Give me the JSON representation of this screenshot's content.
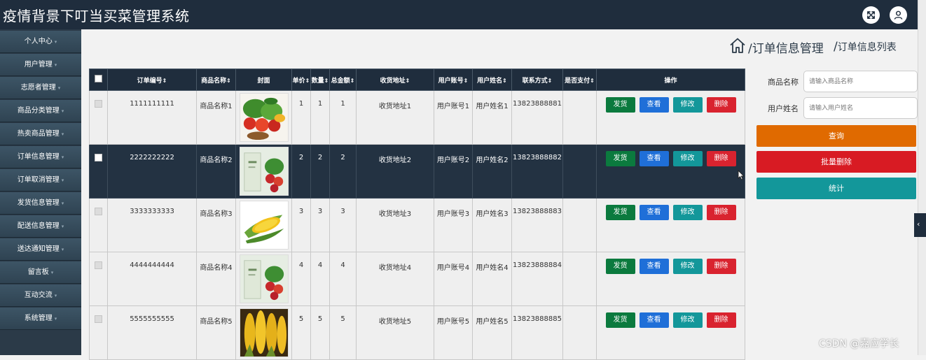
{
  "app": {
    "title": "疫情背景下叮当买菜管理系统"
  },
  "topbar": {
    "icons": [
      "fullscreen-icon",
      "user-icon"
    ]
  },
  "sidebar": {
    "items": [
      {
        "label": "个人中心"
      },
      {
        "label": "用户管理"
      },
      {
        "label": "志愿者管理"
      },
      {
        "label": "商品分类管理"
      },
      {
        "label": "热卖商品管理"
      },
      {
        "label": "订单信息管理"
      },
      {
        "label": "订单取消管理"
      },
      {
        "label": "发货信息管理"
      },
      {
        "label": "配送信息管理"
      },
      {
        "label": "送达通知管理"
      },
      {
        "label": "留言板"
      },
      {
        "label": "互动交流"
      },
      {
        "label": "系统管理"
      }
    ]
  },
  "breadcrumb": {
    "section": "订单信息管理",
    "page": "订单信息列表",
    "separator": "/"
  },
  "table": {
    "headers": {
      "order_no": "订单编号",
      "product_name": "商品名称",
      "cover": "封面",
      "unit_price": "单价",
      "quantity": "数量",
      "total": "总金额",
      "address": "收货地址",
      "account": "用户账号",
      "user_name": "用户姓名",
      "phone": "联系方式",
      "paid": "是否支付",
      "actions": "操作"
    },
    "sort_glyph": "⇕",
    "rows": [
      {
        "order_no": "1111111111",
        "product_name": "商品名称1",
        "cover": "vegetable-basket",
        "unit_price": "1",
        "quantity": "1",
        "total": "1",
        "address": "收货地址1",
        "account": "用户账号1",
        "user_name": "用户姓名1",
        "phone": "13823888881",
        "paid": ""
      },
      {
        "order_no": "2222222222",
        "product_name": "商品名称2",
        "cover": "vegetable-box",
        "unit_price": "2",
        "quantity": "2",
        "total": "2",
        "address": "收货地址2",
        "account": "用户账号2",
        "user_name": "用户姓名2",
        "phone": "13823888882",
        "paid": ""
      },
      {
        "order_no": "3333333333",
        "product_name": "商品名称3",
        "cover": "corn",
        "unit_price": "3",
        "quantity": "3",
        "total": "3",
        "address": "收货地址3",
        "account": "用户账号3",
        "user_name": "用户姓名3",
        "phone": "13823888883",
        "paid": ""
      },
      {
        "order_no": "4444444444",
        "product_name": "商品名称4",
        "cover": "vegetable-box",
        "unit_price": "4",
        "quantity": "4",
        "total": "4",
        "address": "收货地址4",
        "account": "用户账号4",
        "user_name": "用户姓名4",
        "phone": "13823888884",
        "paid": ""
      },
      {
        "order_no": "5555555555",
        "product_name": "商品名称5",
        "cover": "corn-bundle",
        "unit_price": "5",
        "quantity": "5",
        "total": "5",
        "address": "收货地址5",
        "account": "用户账号5",
        "user_name": "用户姓名5",
        "phone": "13823888885",
        "paid": ""
      }
    ],
    "row_actions": {
      "ship": "发货",
      "view": "查看",
      "edit": "修改",
      "delete": "删除"
    }
  },
  "search": {
    "product_label": "商品名称",
    "product_placeholder": "请输入商品名称",
    "user_label": "用户姓名",
    "user_placeholder": "请输入用户姓名",
    "query_button": "查询",
    "batch_delete_button": "批量删除",
    "stats_button": "统计"
  },
  "colors": {
    "topbar": "#1f2d3d",
    "sidebar": "#2f4352",
    "ship": "#0b7a3e",
    "view": "#1f6fd8",
    "edit": "#13979a",
    "delete": "#d9232f",
    "query": "#e06a00",
    "batch_delete": "#d81b23",
    "stats": "#13979a"
  },
  "watermark": "CSDN @嘉应学长"
}
